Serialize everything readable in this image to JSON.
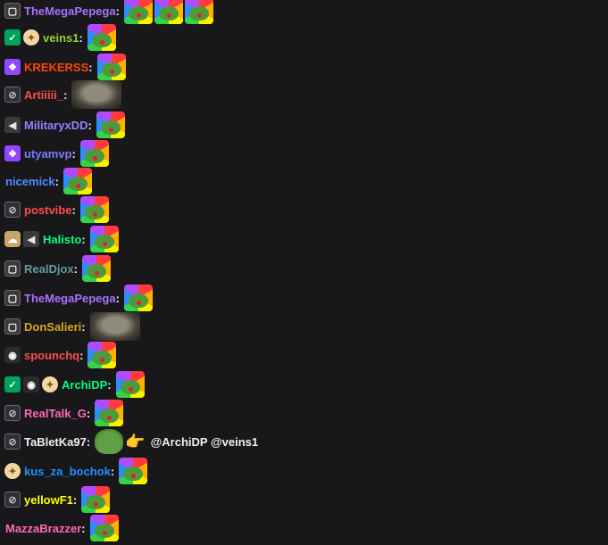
{
  "chat": {
    "messages": [
      {
        "badges": [
          "bits"
        ],
        "username": "TheMegaPepega",
        "color": "#a970ff",
        "emotes": [
          "clown-pepe",
          "clown-pepe",
          "clown-pepe"
        ],
        "text": ""
      },
      {
        "badges": [
          "vip",
          "gift"
        ],
        "username": "veins1",
        "color": "#9acd32",
        "emotes": [
          "clown-pepe"
        ],
        "text": ""
      },
      {
        "badges": [
          "sub"
        ],
        "username": "KREKERSS",
        "color": "#ff4500",
        "emotes": [
          "clown-pepe"
        ],
        "text": ""
      },
      {
        "badges": [
          "prime"
        ],
        "username": "Artiiiii_",
        "color": "#ff4b4b",
        "emotes": [
          "grinning-dog"
        ],
        "text": ""
      },
      {
        "badges": [
          "mute"
        ],
        "username": "MilitaryxDD",
        "color": "#9b7cff",
        "emotes": [
          "clown-pepe"
        ],
        "text": ""
      },
      {
        "badges": [
          "sub"
        ],
        "username": "utyamvp",
        "color": "#7b7bff",
        "emotes": [
          "clown-pepe"
        ],
        "text": ""
      },
      {
        "badges": [],
        "username": "nicemick",
        "color": "#4f8cff",
        "emotes": [
          "clown-pepe"
        ],
        "text": ""
      },
      {
        "badges": [
          "prime"
        ],
        "username": "postvibe",
        "color": "#ff4b4b",
        "emotes": [
          "clown-pepe"
        ],
        "text": ""
      },
      {
        "badges": [
          "cloud",
          "mute"
        ],
        "username": "Halisto",
        "color": "#00ff7f",
        "emotes": [
          "clown-pepe"
        ],
        "text": ""
      },
      {
        "badges": [
          "bits"
        ],
        "username": "RealDjox",
        "color": "#5f9ea0",
        "emotes": [
          "clown-pepe"
        ],
        "text": ""
      },
      {
        "badges": [
          "bits"
        ],
        "username": "TheMegaPepega",
        "color": "#a970ff",
        "emotes": [
          "clown-pepe"
        ],
        "text": ""
      },
      {
        "badges": [
          "bits"
        ],
        "username": "DonSalieri",
        "color": "#daa520",
        "emotes": [
          "grinning-dog"
        ],
        "text": ""
      },
      {
        "badges": [
          "sushi"
        ],
        "username": "spounchq",
        "color": "#ff4b4b",
        "emotes": [
          "clown-pepe"
        ],
        "text": ""
      },
      {
        "badges": [
          "vip",
          "sushi",
          "gift"
        ],
        "username": "ArchiDP",
        "color": "#00ff7f",
        "emotes": [
          "clown-pepe"
        ],
        "text": ""
      },
      {
        "badges": [
          "prime"
        ],
        "username": "RealTalk_G",
        "color": "#ff69b4",
        "emotes": [
          "clown-pepe"
        ],
        "text": ""
      },
      {
        "badges": [
          "prime"
        ],
        "username": "TaBletKa97",
        "color": "#efeff1",
        "emotes": [
          "pepe-point"
        ],
        "text": "@ArchiDP @veins1"
      },
      {
        "badges": [
          "gift"
        ],
        "username": "kus_za_bochok",
        "color": "#1e90ff",
        "emotes": [
          "clown-pepe"
        ],
        "text": ""
      },
      {
        "badges": [
          "prime"
        ],
        "username": "yellowF1",
        "color": "#ffff00",
        "emotes": [
          "clown-pepe"
        ],
        "text": ""
      },
      {
        "badges": [],
        "username": "MazzaBrazzer",
        "color": "#ff69b4",
        "emotes": [
          "clown-pepe"
        ],
        "text": ""
      }
    ]
  }
}
